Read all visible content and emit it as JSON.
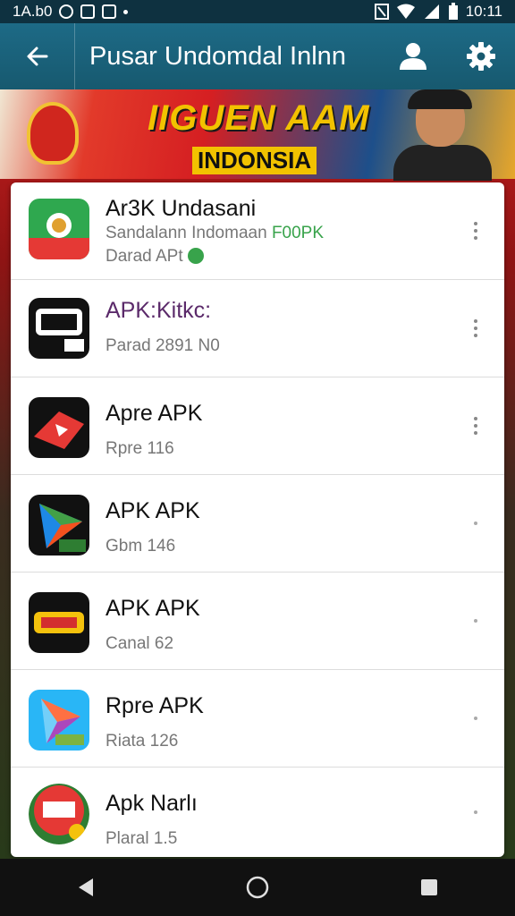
{
  "status_bar": {
    "left_text": "1A.b0",
    "time": "10:11"
  },
  "app_bar": {
    "title": "Pusar Undomdal Inlnn"
  },
  "banner": {
    "headline": "IIGUEN AAM",
    "subline": "INDONSIA"
  },
  "items": [
    {
      "title": "Ar3K Undasani",
      "subtitle": "Sandalann Indomaan",
      "subtitle_tag": "F00PK",
      "meta": "Darad APt",
      "icon": "undasani-icon",
      "icon_colors": [
        "#2fa84f",
        "#e53935"
      ]
    },
    {
      "title": "APK:Kitkc:",
      "subtitle": "",
      "meta": "Parad 2891 N0",
      "icon": "aip-icon",
      "icon_colors": [
        "#111111",
        "#ffffff"
      ],
      "title_color": "#5b2a6a"
    },
    {
      "title": "Apre APK",
      "subtitle": "",
      "meta": "Rpre 116",
      "icon": "red-play-icon",
      "icon_colors": [
        "#111111",
        "#e53935"
      ]
    },
    {
      "title": "APK APK",
      "subtitle": "",
      "meta": "Gbm 146",
      "icon": "gradient-play-icon",
      "icon_colors": [
        "#111111",
        "#1e88e5"
      ]
    },
    {
      "title": "APK APK",
      "subtitle": "",
      "meta": "Canal 62",
      "icon": "apk-logo-icon",
      "icon_colors": [
        "#111111",
        "#f4c20d"
      ]
    },
    {
      "title": "Rpre APK",
      "subtitle": "",
      "meta": "Riata 126",
      "icon": "blue-play-icon",
      "icon_colors": [
        "#29b6f6",
        "#ff7043"
      ]
    },
    {
      "title": "Apk Narlı",
      "subtitle": "",
      "meta": "Plaral 1.5",
      "icon": "apk-badge-icon",
      "icon_colors": [
        "#e53935",
        "#2e7d32"
      ]
    }
  ],
  "nav": {
    "back": "back-icon",
    "home": "home-icon",
    "recents": "recents-icon"
  }
}
